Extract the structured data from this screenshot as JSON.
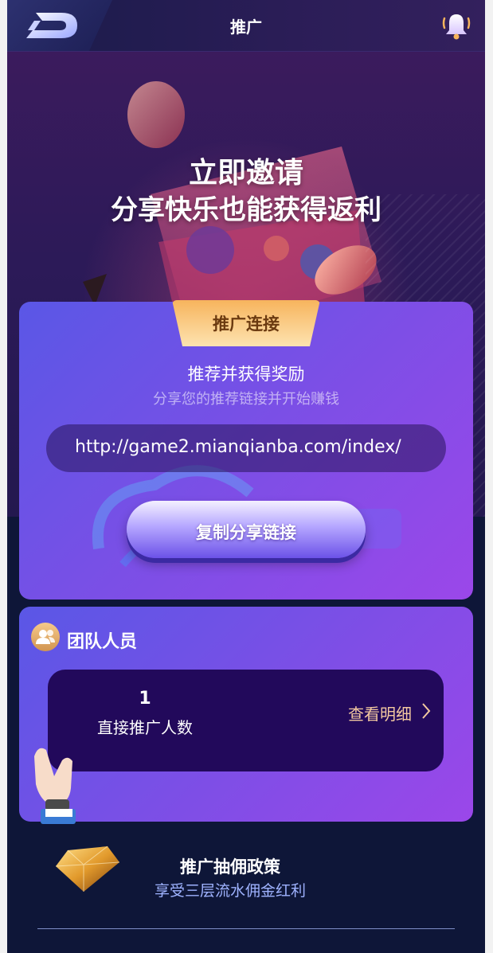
{
  "header": {
    "title": "推广",
    "logo_icon": "logo-d-icon",
    "bell_icon": "bell-icon"
  },
  "hero": {
    "line1": "立即邀请",
    "line2": "分享快乐也能获得返利"
  },
  "referral": {
    "ribbon_label": "推广连接",
    "title": "推荐并获得奖励",
    "subtitle": "分享您的推荐链接并开始赚钱",
    "link": "http://game2.mianqianba.com/index/",
    "copy_button": "复制分享链接"
  },
  "team": {
    "title": "团队人员",
    "count": "1",
    "count_label": "直接推广人数",
    "detail_link": "查看明细"
  },
  "policy": {
    "title": "推广抽佣政策",
    "subtitle": "享受三层流水佣金红利"
  },
  "colors": {
    "card_gradient_start": "#5a57e6",
    "card_gradient_end": "#9b47e9",
    "ribbon": "#f7b45d",
    "detail_link": "#f3c9a0",
    "background": "#0e1638"
  }
}
